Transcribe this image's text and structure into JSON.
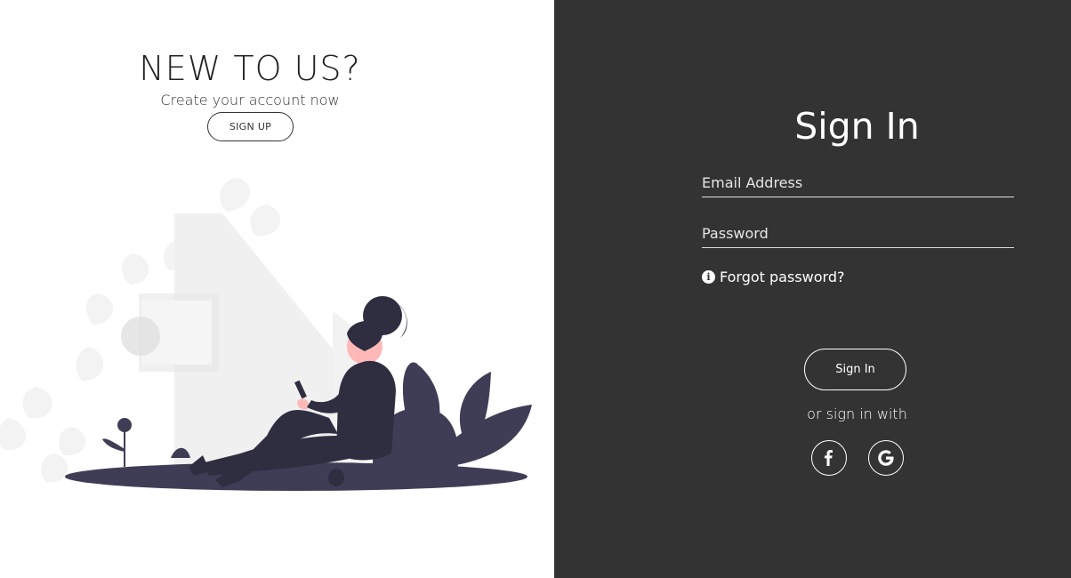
{
  "left": {
    "title": "NEW TO US?",
    "subtitle": "Create your account now",
    "signup_label": "SIGN UP"
  },
  "right": {
    "title": "Sign In",
    "email_placeholder": "Email Address",
    "password_placeholder": "Password",
    "forgot_label": "Forgot password?",
    "signin_label": "Sign In",
    "or_text": "or sign in with",
    "social": [
      "facebook-icon",
      "google-icon"
    ]
  },
  "colors": {
    "dark_panel": "#333333",
    "light_panel": "#ffffff",
    "figure": "#3f3d56",
    "skin": "#ffb8b8"
  }
}
